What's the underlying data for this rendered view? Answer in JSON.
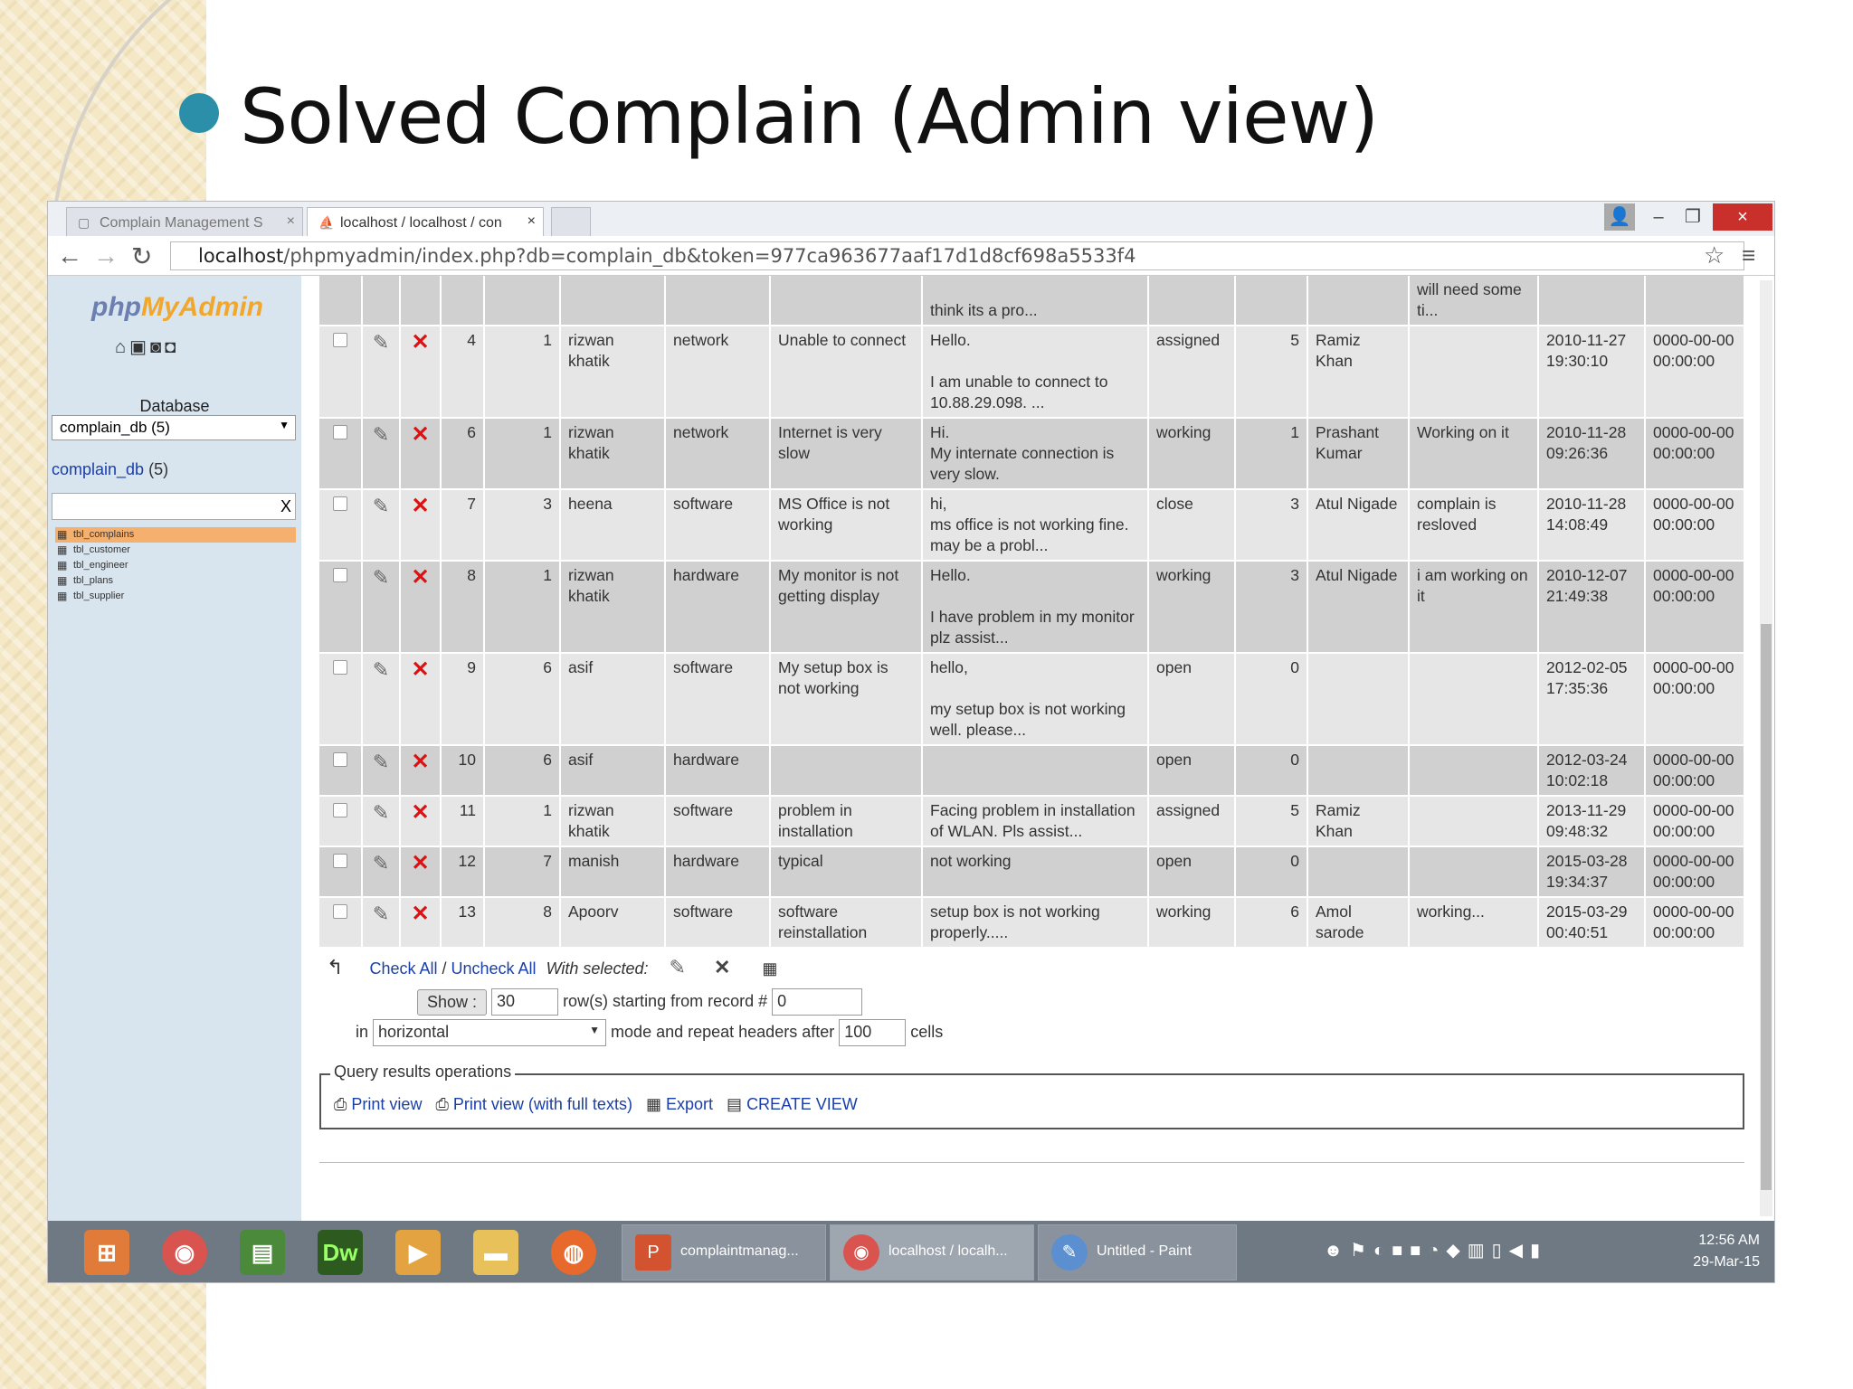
{
  "slide": {
    "title": "Solved Complain (Admin view)"
  },
  "browser": {
    "tabs": [
      {
        "label": "Complain Management S",
        "active": false
      },
      {
        "label": "localhost / localhost / con",
        "active": true
      }
    ],
    "url_host": "localhost",
    "url_rest": "/phpmyadmin/index.php?db=complain_db&token=977ca963677aaf17d1d8cf698a5533f4"
  },
  "sidebar": {
    "logo_a": "php",
    "logo_b": "MyAdmin",
    "db_label": "Database",
    "db_select": "complain_db (5)",
    "db_link": "complain_db",
    "db_link_count": "(5)",
    "filter_clear": "X",
    "tables": [
      "tbl_complains",
      "tbl_customer",
      "tbl_engineer",
      "tbl_plans",
      "tbl_supplier"
    ]
  },
  "grid": {
    "partial_row": {
      "c9": "think its a pro...",
      "c13": "will need some ti..."
    },
    "rows": [
      {
        "id": "4",
        "cust": "1",
        "name": "rizwan khatik",
        "type": "network",
        "subject": "Unable to connect",
        "desc": "Hello.\n\nI am unable to connect to 10.88.29.098. ...",
        "status": "assigned",
        "eng": "5",
        "engname": "Ramiz Khan",
        "remark": "",
        "created": "2010-11-27 19:30:10",
        "closed": "0000-00-00 00:00:00"
      },
      {
        "id": "6",
        "cust": "1",
        "name": "rizwan khatik",
        "type": "network",
        "subject": "Internet is very slow",
        "desc": "Hi.\nMy internate connection is very slow.",
        "status": "working",
        "eng": "1",
        "engname": "Prashant Kumar",
        "remark": "Working on it",
        "created": "2010-11-28 09:26:36",
        "closed": "0000-00-00 00:00:00"
      },
      {
        "id": "7",
        "cust": "3",
        "name": "heena",
        "type": "software",
        "subject": "MS Office is not working",
        "desc": "hi,\nms office is not working fine. may be a probl...",
        "status": "close",
        "eng": "3",
        "engname": "Atul Nigade",
        "remark": "complain is resloved",
        "created": "2010-11-28 14:08:49",
        "closed": "0000-00-00 00:00:00"
      },
      {
        "id": "8",
        "cust": "1",
        "name": "rizwan khatik",
        "type": "hardware",
        "subject": "My monitor is not getting display",
        "desc": "Hello.\n\nI have problem in my monitor\nplz assist...",
        "status": "working",
        "eng": "3",
        "engname": "Atul Nigade",
        "remark": "i am working on it",
        "created": "2010-12-07 21:49:38",
        "closed": "0000-00-00 00:00:00"
      },
      {
        "id": "9",
        "cust": "6",
        "name": "asif",
        "type": "software",
        "subject": "My setup box is not working",
        "desc": "hello,\n\nmy setup box is not working well. please...",
        "status": "open",
        "eng": "0",
        "engname": "",
        "remark": "",
        "created": "2012-02-05 17:35:36",
        "closed": "0000-00-00 00:00:00"
      },
      {
        "id": "10",
        "cust": "6",
        "name": "asif",
        "type": "hardware",
        "subject": "",
        "desc": "",
        "status": "open",
        "eng": "0",
        "engname": "",
        "remark": "",
        "created": "2012-03-24 10:02:18",
        "closed": "0000-00-00 00:00:00"
      },
      {
        "id": "11",
        "cust": "1",
        "name": "rizwan khatik",
        "type": "software",
        "subject": "problem in installation",
        "desc": "Facing problem in installation of WLAN. Pls assist...",
        "status": "assigned",
        "eng": "5",
        "engname": "Ramiz Khan",
        "remark": "",
        "created": "2013-11-29 09:48:32",
        "closed": "0000-00-00 00:00:00"
      },
      {
        "id": "12",
        "cust": "7",
        "name": "manish",
        "type": "hardware",
        "subject": "typical",
        "desc": "not working",
        "status": "open",
        "eng": "0",
        "engname": "",
        "remark": "",
        "created": "2015-03-28 19:34:37",
        "closed": "0000-00-00 00:00:00"
      },
      {
        "id": "13",
        "cust": "8",
        "name": "Apoorv",
        "type": "software",
        "subject": "software reinstallation",
        "desc": "setup box is not working properly.....",
        "status": "working",
        "eng": "6",
        "engname": "Amol sarode",
        "remark": "working...",
        "created": "2015-03-29 00:40:51",
        "closed": "0000-00-00 00:00:00"
      }
    ]
  },
  "actions": {
    "check_all": "Check All",
    "sep": " / ",
    "uncheck_all": "Uncheck All",
    "with_selected": "With selected:",
    "show_btn": "Show :",
    "show_count": "30",
    "rows_text": "row(s) starting from record #",
    "start_record": "0",
    "in_text": "in",
    "mode": "horizontal",
    "mode_text": "mode and repeat headers after",
    "repeat": "100",
    "cells_text": "cells"
  },
  "query_ops": {
    "legend": "Query results operations",
    "print_view": "Print view",
    "print_full": "Print view (with full texts)",
    "export": "Export",
    "create_view": "CREATE VIEW"
  },
  "taskbar": {
    "tasks": [
      "complaintmanag...",
      "localhost / localh...",
      "Untitled - Paint"
    ],
    "time": "12:56 AM",
    "date": "29-Mar-15"
  }
}
